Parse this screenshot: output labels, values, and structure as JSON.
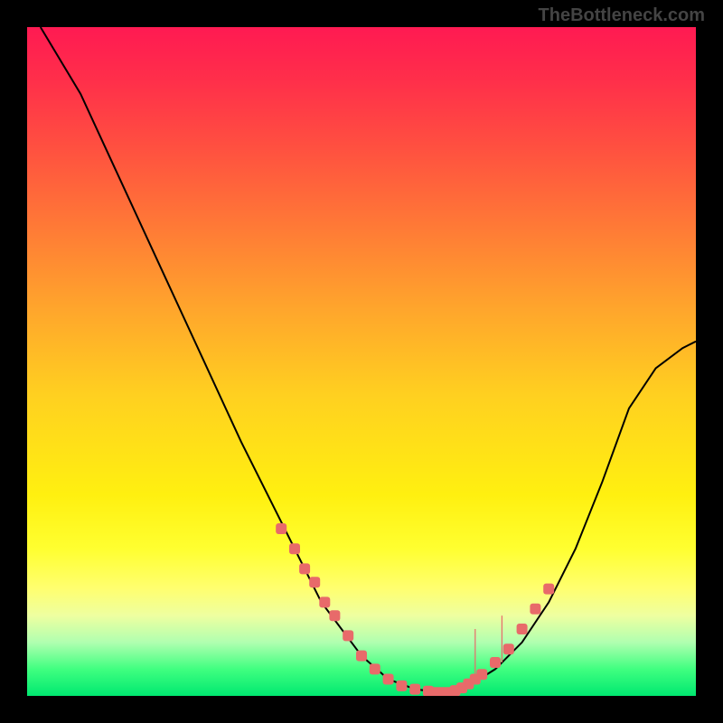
{
  "watermark": "TheBottleneck.com",
  "chart_data": {
    "type": "line",
    "title": "",
    "xlabel": "",
    "ylabel": "",
    "xlim": [
      0,
      100
    ],
    "ylim": [
      0,
      100
    ],
    "curve_left": {
      "x": [
        2,
        8,
        14,
        20,
        26,
        32,
        38,
        44,
        50,
        54,
        58,
        62
      ],
      "y": [
        100,
        90,
        77,
        64,
        51,
        38,
        26,
        14,
        6,
        2.5,
        1,
        0.5
      ]
    },
    "curve_right": {
      "x": [
        62,
        66,
        70,
        74,
        78,
        82,
        86,
        90,
        94,
        98,
        100
      ],
      "y": [
        0.5,
        1.5,
        4,
        8,
        14,
        22,
        32,
        43,
        49,
        52,
        53
      ]
    },
    "markers_left": {
      "x": [
        38,
        40,
        41.5,
        43,
        44.5,
        46,
        48,
        50,
        52,
        54,
        56,
        58,
        60,
        61,
        62,
        63
      ],
      "y": [
        25,
        22,
        19,
        17,
        14,
        12,
        9,
        6,
        4,
        2.5,
        1.5,
        1,
        0.7,
        0.5,
        0.5,
        0.5
      ]
    },
    "markers_right": {
      "x": [
        64,
        65,
        66,
        67,
        68,
        70,
        72,
        74,
        76,
        78
      ],
      "y": [
        0.8,
        1.2,
        1.8,
        2.5,
        3.2,
        5,
        7,
        10,
        13,
        16
      ]
    },
    "spikes": [
      {
        "x": 67,
        "y0": 3,
        "y1": 10
      },
      {
        "x": 71,
        "y0": 5,
        "y1": 12
      }
    ],
    "colors": {
      "curve": "#000000",
      "marker": "#e86a6a",
      "gradient_top": "#ff1a52",
      "gradient_bottom": "#00e870"
    }
  }
}
